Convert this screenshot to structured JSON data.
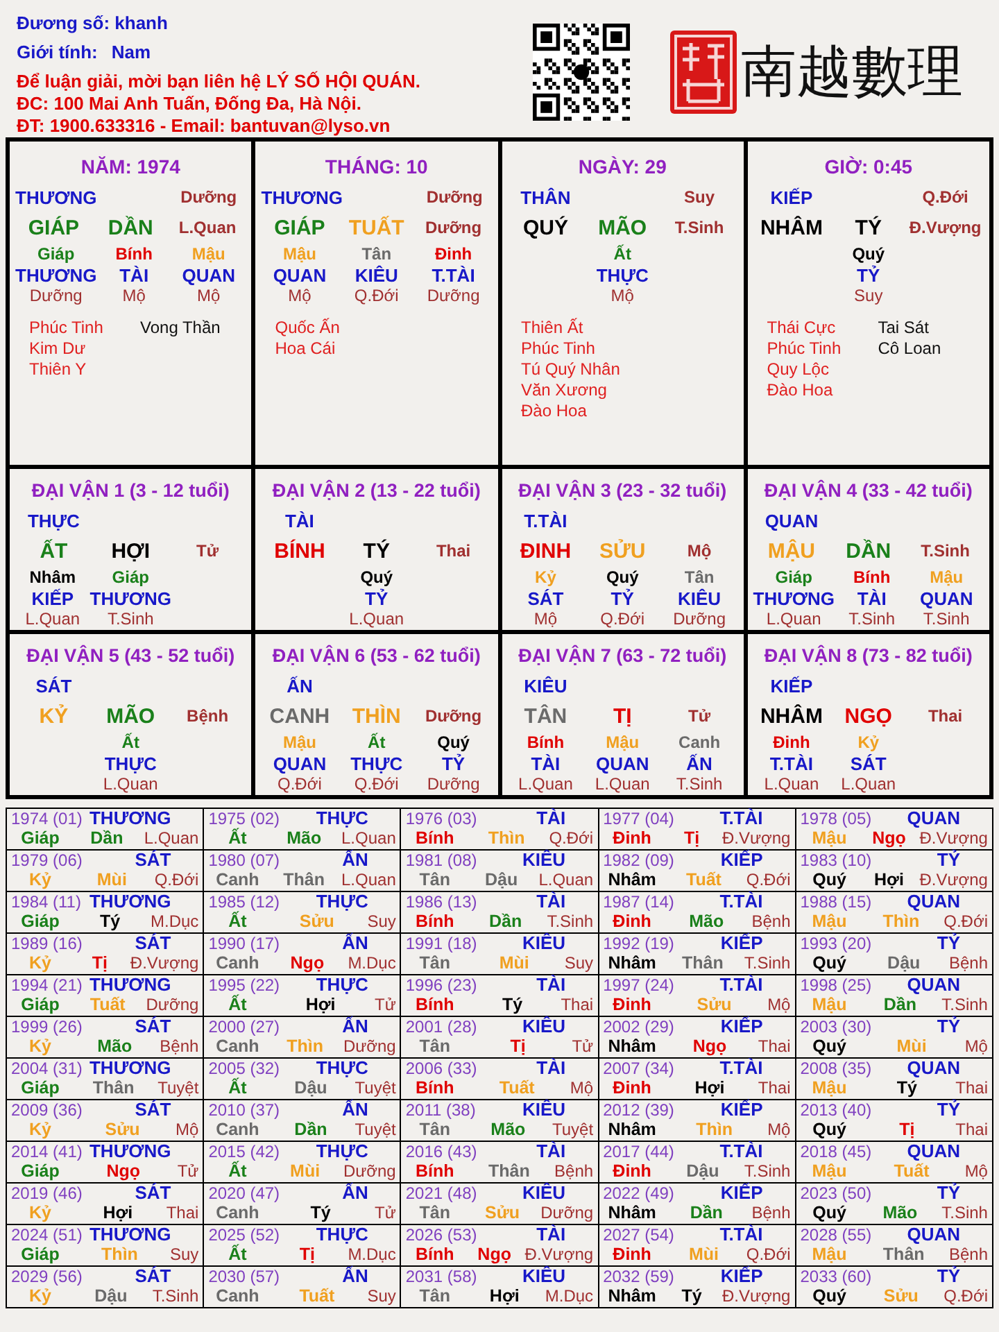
{
  "header": {
    "owner": "Đương số: khanh",
    "gender_label": "Giới tính:",
    "gender": "Nam",
    "contact_lines": [
      "Để luận giải, mời bạn liên hệ LÝ SỐ HỘI QUÁN.",
      "ĐC: 100 Mai Anh Tuấn, Đống Đa, Hà Nội.",
      "ĐT: 1900.633316 - Email: bantuvan@lyso.vn"
    ],
    "brand": "南越數理"
  },
  "pillars": [
    {
      "title": "NĂM: 1974",
      "god": "THƯƠNG",
      "stem_stage": "Dưỡng",
      "stem": {
        "text": "GIÁP",
        "color": "#1a801a"
      },
      "branch": {
        "text": "DẦN",
        "color": "#1a801a"
      },
      "branch_stage": "L.Quan",
      "hidden": [
        {
          "stem": "Giáp",
          "color": "#1a801a",
          "god": "THƯƠNG",
          "stage": "Dưỡng"
        },
        {
          "stem": "Bính",
          "color": "#e00000",
          "god": "TÀI",
          "stage": "Mộ"
        },
        {
          "stem": "Mậu",
          "color": "#f0a020",
          "god": "QUAN",
          "stage": "Mộ"
        }
      ],
      "star_names_1": [
        "Phúc Tinh",
        "Kim Dư",
        "Thiên Y"
      ],
      "star_names_2": [
        "Vong Thần"
      ]
    },
    {
      "title": "THÁNG: 10",
      "god": "THƯƠNG",
      "stem_stage": "Dưỡng",
      "stem": {
        "text": "GIÁP",
        "color": "#1a801a"
      },
      "branch": {
        "text": "TUẤT",
        "color": "#f0a020"
      },
      "branch_stage": "Dưỡng",
      "hidden": [
        {
          "stem": "Mậu",
          "color": "#f0a020",
          "god": "QUAN",
          "stage": "Mộ"
        },
        {
          "stem": "Tân",
          "color": "#6a6a6a",
          "god": "KIÊU",
          "stage": "Q.Đới"
        },
        {
          "stem": "Đinh",
          "color": "#e00000",
          "god": "T.TÀI",
          "stage": "Dưỡng"
        }
      ],
      "star_names_1": [
        "Quốc Ấn",
        "Hoa Cái"
      ]
    },
    {
      "title": "NGÀY: 29",
      "god": "THÂN",
      "stem_stage": "Suy",
      "stem": {
        "text": "QUÝ",
        "color": "#000000"
      },
      "branch": {
        "text": "MÃO",
        "color": "#1a801a"
      },
      "branch_stage": "T.Sinh",
      "hidden": [
        {
          "stem": "Ất",
          "color": "#1a801a",
          "god": "THỰC",
          "stage": "Mộ"
        }
      ],
      "star_names_1": [
        "Thiên Ất",
        "Phúc Tinh",
        "Tú Quý Nhân",
        "Văn Xương",
        "Đào Hoa"
      ]
    },
    {
      "title": "GIỜ: 0:45",
      "god": "KIẾP",
      "stem_stage": "Q.Đới",
      "stem": {
        "text": "NHÂM",
        "color": "#000000"
      },
      "branch": {
        "text": "TÝ",
        "color": "#000000"
      },
      "branch_stage": "Đ.Vượng",
      "hidden": [
        {
          "stem": "Quý",
          "color": "#000000",
          "god": "TỶ",
          "stage": "Suy"
        }
      ],
      "star_names_1": [
        "Thái Cực",
        "Phúc Tinh",
        "Quy Lộc",
        "Đào Hoa"
      ],
      "star_names_2": [
        "Tai Sát",
        "Cô Loan"
      ]
    }
  ],
  "luck_periods": [
    {
      "title": "ĐẠI VẬN 1 (3 - 12 tuổi)",
      "god": "THỰC",
      "stem": {
        "text": "ẤT",
        "color": "#1a801a"
      },
      "branch": {
        "text": "HỢI",
        "color": "#000000"
      },
      "stage": "Tử",
      "hidden": [
        {
          "stem": "Nhâm",
          "color": "#000000",
          "god": "KIẾP",
          "stage": "L.Quan"
        },
        {
          "stem": "Giáp",
          "color": "#1a801a",
          "god": "THƯƠNG",
          "stage": "T.Sinh"
        }
      ]
    },
    {
      "title": "ĐẠI VẬN 2 (13 - 22 tuổi)",
      "god": "TÀI",
      "stem": {
        "text": "BÍNH",
        "color": "#e00000"
      },
      "branch": {
        "text": "TÝ",
        "color": "#000000"
      },
      "stage": "Thai",
      "hidden": [
        {
          "stem": "Quý",
          "color": "#000000",
          "god": "TỶ",
          "stage": "L.Quan"
        }
      ]
    },
    {
      "title": "ĐẠI VẬN 3 (23 - 32 tuổi)",
      "god": "T.TÀI",
      "stem": {
        "text": "ĐINH",
        "color": "#e00000"
      },
      "branch": {
        "text": "SỬU",
        "color": "#f0a020"
      },
      "stage": "Mộ",
      "hidden": [
        {
          "stem": "Kỷ",
          "color": "#f0a020",
          "god": "SÁT",
          "stage": "Mộ"
        },
        {
          "stem": "Quý",
          "color": "#000000",
          "god": "TỶ",
          "stage": "Q.Đới"
        },
        {
          "stem": "Tân",
          "color": "#6a6a6a",
          "god": "KIÊU",
          "stage": "Dưỡng"
        }
      ]
    },
    {
      "title": "ĐẠI VẬN 4 (33 - 42 tuổi)",
      "god": "QUAN",
      "stem": {
        "text": "MẬU",
        "color": "#f0a020"
      },
      "branch": {
        "text": "DẦN",
        "color": "#1a801a"
      },
      "stage": "T.Sinh",
      "hidden": [
        {
          "stem": "Giáp",
          "color": "#1a801a",
          "god": "THƯƠNG",
          "stage": "L.Quan"
        },
        {
          "stem": "Bính",
          "color": "#e00000",
          "god": "TÀI",
          "stage": "T.Sinh"
        },
        {
          "stem": "Mậu",
          "color": "#f0a020",
          "god": "QUAN",
          "stage": "T.Sinh"
        }
      ]
    },
    {
      "title": "ĐẠI VẬN 5 (43 - 52 tuổi)",
      "god": "SÁT",
      "stem": {
        "text": "KỶ",
        "color": "#f0a020"
      },
      "branch": {
        "text": "MÃO",
        "color": "#1a801a"
      },
      "stage": "Bệnh",
      "hidden": [
        {
          "stem": "Ất",
          "color": "#1a801a",
          "god": "THỰC",
          "stage": "L.Quan"
        }
      ]
    },
    {
      "title": "ĐẠI VẬN 6 (53 - 62 tuổi)",
      "god": "ẤN",
      "stem": {
        "text": "CANH",
        "color": "#6a6a6a"
      },
      "branch": {
        "text": "THÌN",
        "color": "#f0a020"
      },
      "stage": "Dưỡng",
      "hidden": [
        {
          "stem": "Mậu",
          "color": "#f0a020",
          "god": "QUAN",
          "stage": "Q.Đới"
        },
        {
          "stem": "Ất",
          "color": "#1a801a",
          "god": "THỰC",
          "stage": "Q.Đới"
        },
        {
          "stem": "Quý",
          "color": "#000000",
          "god": "TỶ",
          "stage": "Dưỡng"
        }
      ]
    },
    {
      "title": "ĐẠI VẬN 7 (63 - 72 tuổi)",
      "god": "KIÊU",
      "stem": {
        "text": "TÂN",
        "color": "#6a6a6a"
      },
      "branch": {
        "text": "TỊ",
        "color": "#e00000"
      },
      "stage": "Tử",
      "hidden": [
        {
          "stem": "Bính",
          "color": "#e00000",
          "god": "TÀI",
          "stage": "L.Quan"
        },
        {
          "stem": "Mậu",
          "color": "#f0a020",
          "god": "QUAN",
          "stage": "L.Quan"
        },
        {
          "stem": "Canh",
          "color": "#6a6a6a",
          "god": "ẤN",
          "stage": "T.Sinh"
        }
      ]
    },
    {
      "title": "ĐẠI VẬN 8 (73 - 82 tuổi)",
      "god": "KIẾP",
      "stem": {
        "text": "NHÂM",
        "color": "#000000"
      },
      "branch": {
        "text": "NGỌ",
        "color": "#e00000"
      },
      "stage": "Thai",
      "hidden": [
        {
          "stem": "Đinh",
          "color": "#e00000",
          "god": "T.TÀI",
          "stage": "L.Quan"
        },
        {
          "stem": "Kỷ",
          "color": "#f0a020",
          "god": "SÁT",
          "stage": "L.Quan"
        }
      ]
    }
  ],
  "years": [
    {
      "year": "1974 (01)",
      "god": "THƯƠNG",
      "stem": {
        "text": "Giáp",
        "color": "#1a801a"
      },
      "branch": {
        "text": "Dần",
        "color": "#1a801a"
      },
      "stage": "L.Quan"
    },
    {
      "year": "1975 (02)",
      "god": "THỰC",
      "stem": {
        "text": "Ất",
        "color": "#1a801a"
      },
      "branch": {
        "text": "Mão",
        "color": "#1a801a"
      },
      "stage": "L.Quan"
    },
    {
      "year": "1976 (03)",
      "god": "TÀI",
      "stem": {
        "text": "Bính",
        "color": "#e00000"
      },
      "branch": {
        "text": "Thìn",
        "color": "#f0a020"
      },
      "stage": "Q.Đới"
    },
    {
      "year": "1977 (04)",
      "god": "T.TÀI",
      "stem": {
        "text": "Đinh",
        "color": "#e00000"
      },
      "branch": {
        "text": "Tị",
        "color": "#e00000"
      },
      "stage": "Đ.Vượng"
    },
    {
      "year": "1978 (05)",
      "god": "QUAN",
      "stem": {
        "text": "Mậu",
        "color": "#f0a020"
      },
      "branch": {
        "text": "Ngọ",
        "color": "#e00000"
      },
      "stage": "Đ.Vượng"
    },
    {
      "year": "1979 (06)",
      "god": "SÁT",
      "stem": {
        "text": "Kỷ",
        "color": "#f0a020"
      },
      "branch": {
        "text": "Mùi",
        "color": "#f0a020"
      },
      "stage": "Q.Đới"
    },
    {
      "year": "1980 (07)",
      "god": "ẤN",
      "stem": {
        "text": "Canh",
        "color": "#6a6a6a"
      },
      "branch": {
        "text": "Thân",
        "color": "#6a6a6a"
      },
      "stage": "L.Quan"
    },
    {
      "year": "1981 (08)",
      "god": "KIÊU",
      "stem": {
        "text": "Tân",
        "color": "#6a6a6a"
      },
      "branch": {
        "text": "Dậu",
        "color": "#6a6a6a"
      },
      "stage": "L.Quan"
    },
    {
      "year": "1982 (09)",
      "god": "KIẾP",
      "stem": {
        "text": "Nhâm",
        "color": "#000000"
      },
      "branch": {
        "text": "Tuất",
        "color": "#f0a020"
      },
      "stage": "Q.Đới"
    },
    {
      "year": "1983 (10)",
      "god": "TỶ",
      "stem": {
        "text": "Quý",
        "color": "#000000"
      },
      "branch": {
        "text": "Hợi",
        "color": "#000000"
      },
      "stage": "Đ.Vượng"
    },
    {
      "year": "1984 (11)",
      "god": "THƯƠNG",
      "stem": {
        "text": "Giáp",
        "color": "#1a801a"
      },
      "branch": {
        "text": "Tý",
        "color": "#000000"
      },
      "stage": "M.Dục"
    },
    {
      "year": "1985 (12)",
      "god": "THỰC",
      "stem": {
        "text": "Ất",
        "color": "#1a801a"
      },
      "branch": {
        "text": "Sửu",
        "color": "#f0a020"
      },
      "stage": "Suy"
    },
    {
      "year": "1986 (13)",
      "god": "TÀI",
      "stem": {
        "text": "Bính",
        "color": "#e00000"
      },
      "branch": {
        "text": "Dần",
        "color": "#1a801a"
      },
      "stage": "T.Sinh"
    },
    {
      "year": "1987 (14)",
      "god": "T.TÀI",
      "stem": {
        "text": "Đinh",
        "color": "#e00000"
      },
      "branch": {
        "text": "Mão",
        "color": "#1a801a"
      },
      "stage": "Bệnh"
    },
    {
      "year": "1988 (15)",
      "god": "QUAN",
      "stem": {
        "text": "Mậu",
        "color": "#f0a020"
      },
      "branch": {
        "text": "Thìn",
        "color": "#f0a020"
      },
      "stage": "Q.Đới"
    },
    {
      "year": "1989 (16)",
      "god": "SÁT",
      "stem": {
        "text": "Kỷ",
        "color": "#f0a020"
      },
      "branch": {
        "text": "Tị",
        "color": "#e00000"
      },
      "stage": "Đ.Vượng"
    },
    {
      "year": "1990 (17)",
      "god": "ẤN",
      "stem": {
        "text": "Canh",
        "color": "#6a6a6a"
      },
      "branch": {
        "text": "Ngọ",
        "color": "#e00000"
      },
      "stage": "M.Dục"
    },
    {
      "year": "1991 (18)",
      "god": "KIÊU",
      "stem": {
        "text": "Tân",
        "color": "#6a6a6a"
      },
      "branch": {
        "text": "Mùi",
        "color": "#f0a020"
      },
      "stage": "Suy"
    },
    {
      "year": "1992 (19)",
      "god": "KIẾP",
      "stem": {
        "text": "Nhâm",
        "color": "#000000"
      },
      "branch": {
        "text": "Thân",
        "color": "#6a6a6a"
      },
      "stage": "T.Sinh"
    },
    {
      "year": "1993 (20)",
      "god": "TỶ",
      "stem": {
        "text": "Quý",
        "color": "#000000"
      },
      "branch": {
        "text": "Dậu",
        "color": "#6a6a6a"
      },
      "stage": "Bệnh"
    },
    {
      "year": "1994 (21)",
      "god": "THƯƠNG",
      "stem": {
        "text": "Giáp",
        "color": "#1a801a"
      },
      "branch": {
        "text": "Tuất",
        "color": "#f0a020"
      },
      "stage": "Dưỡng"
    },
    {
      "year": "1995 (22)",
      "god": "THỰC",
      "stem": {
        "text": "Ất",
        "color": "#1a801a"
      },
      "branch": {
        "text": "Hợi",
        "color": "#000000"
      },
      "stage": "Tử"
    },
    {
      "year": "1996 (23)",
      "god": "TÀI",
      "stem": {
        "text": "Bính",
        "color": "#e00000"
      },
      "branch": {
        "text": "Tý",
        "color": "#000000"
      },
      "stage": "Thai"
    },
    {
      "year": "1997 (24)",
      "god": "T.TÀI",
      "stem": {
        "text": "Đinh",
        "color": "#e00000"
      },
      "branch": {
        "text": "Sửu",
        "color": "#f0a020"
      },
      "stage": "Mộ"
    },
    {
      "year": "1998 (25)",
      "god": "QUAN",
      "stem": {
        "text": "Mậu",
        "color": "#f0a020"
      },
      "branch": {
        "text": "Dần",
        "color": "#1a801a"
      },
      "stage": "T.Sinh"
    },
    {
      "year": "1999 (26)",
      "god": "SÁT",
      "stem": {
        "text": "Kỷ",
        "color": "#f0a020"
      },
      "branch": {
        "text": "Mão",
        "color": "#1a801a"
      },
      "stage": "Bệnh"
    },
    {
      "year": "2000 (27)",
      "god": "ẤN",
      "stem": {
        "text": "Canh",
        "color": "#6a6a6a"
      },
      "branch": {
        "text": "Thìn",
        "color": "#f0a020"
      },
      "stage": "Dưỡng"
    },
    {
      "year": "2001 (28)",
      "god": "KIÊU",
      "stem": {
        "text": "Tân",
        "color": "#6a6a6a"
      },
      "branch": {
        "text": "Tị",
        "color": "#e00000"
      },
      "stage": "Tử"
    },
    {
      "year": "2002 (29)",
      "god": "KIẾP",
      "stem": {
        "text": "Nhâm",
        "color": "#000000"
      },
      "branch": {
        "text": "Ngọ",
        "color": "#e00000"
      },
      "stage": "Thai"
    },
    {
      "year": "2003 (30)",
      "god": "TỶ",
      "stem": {
        "text": "Quý",
        "color": "#000000"
      },
      "branch": {
        "text": "Mùi",
        "color": "#f0a020"
      },
      "stage": "Mộ"
    },
    {
      "year": "2004 (31)",
      "god": "THƯƠNG",
      "stem": {
        "text": "Giáp",
        "color": "#1a801a"
      },
      "branch": {
        "text": "Thân",
        "color": "#6a6a6a"
      },
      "stage": "Tuyệt"
    },
    {
      "year": "2005 (32)",
      "god": "THỰC",
      "stem": {
        "text": "Ất",
        "color": "#1a801a"
      },
      "branch": {
        "text": "Dậu",
        "color": "#6a6a6a"
      },
      "stage": "Tuyệt"
    },
    {
      "year": "2006 (33)",
      "god": "TÀI",
      "stem": {
        "text": "Bính",
        "color": "#e00000"
      },
      "branch": {
        "text": "Tuất",
        "color": "#f0a020"
      },
      "stage": "Mộ"
    },
    {
      "year": "2007 (34)",
      "god": "T.TÀI",
      "stem": {
        "text": "Đinh",
        "color": "#e00000"
      },
      "branch": {
        "text": "Hợi",
        "color": "#000000"
      },
      "stage": "Thai"
    },
    {
      "year": "2008 (35)",
      "god": "QUAN",
      "stem": {
        "text": "Mậu",
        "color": "#f0a020"
      },
      "branch": {
        "text": "Tý",
        "color": "#000000"
      },
      "stage": "Thai"
    },
    {
      "year": "2009 (36)",
      "god": "SÁT",
      "stem": {
        "text": "Kỷ",
        "color": "#f0a020"
      },
      "branch": {
        "text": "Sửu",
        "color": "#f0a020"
      },
      "stage": "Mộ"
    },
    {
      "year": "2010 (37)",
      "god": "ẤN",
      "stem": {
        "text": "Canh",
        "color": "#6a6a6a"
      },
      "branch": {
        "text": "Dần",
        "color": "#1a801a"
      },
      "stage": "Tuyệt"
    },
    {
      "year": "2011 (38)",
      "god": "KIÊU",
      "stem": {
        "text": "Tân",
        "color": "#6a6a6a"
      },
      "branch": {
        "text": "Mão",
        "color": "#1a801a"
      },
      "stage": "Tuyệt"
    },
    {
      "year": "2012 (39)",
      "god": "KIẾP",
      "stem": {
        "text": "Nhâm",
        "color": "#000000"
      },
      "branch": {
        "text": "Thìn",
        "color": "#f0a020"
      },
      "stage": "Mộ"
    },
    {
      "year": "2013 (40)",
      "god": "TỶ",
      "stem": {
        "text": "Quý",
        "color": "#000000"
      },
      "branch": {
        "text": "Tị",
        "color": "#e00000"
      },
      "stage": "Thai"
    },
    {
      "year": "2014 (41)",
      "god": "THƯƠNG",
      "stem": {
        "text": "Giáp",
        "color": "#1a801a"
      },
      "branch": {
        "text": "Ngọ",
        "color": "#e00000"
      },
      "stage": "Tử"
    },
    {
      "year": "2015 (42)",
      "god": "THỰC",
      "stem": {
        "text": "Ất",
        "color": "#1a801a"
      },
      "branch": {
        "text": "Mùi",
        "color": "#f0a020"
      },
      "stage": "Dưỡng"
    },
    {
      "year": "2016 (43)",
      "god": "TÀI",
      "stem": {
        "text": "Bính",
        "color": "#e00000"
      },
      "branch": {
        "text": "Thân",
        "color": "#6a6a6a"
      },
      "stage": "Bệnh"
    },
    {
      "year": "2017 (44)",
      "god": "T.TÀI",
      "stem": {
        "text": "Đinh",
        "color": "#e00000"
      },
      "branch": {
        "text": "Dậu",
        "color": "#6a6a6a"
      },
      "stage": "T.Sinh"
    },
    {
      "year": "2018 (45)",
      "god": "QUAN",
      "stem": {
        "text": "Mậu",
        "color": "#f0a020"
      },
      "branch": {
        "text": "Tuất",
        "color": "#f0a020"
      },
      "stage": "Mộ"
    },
    {
      "year": "2019 (46)",
      "god": "SÁT",
      "stem": {
        "text": "Kỷ",
        "color": "#f0a020"
      },
      "branch": {
        "text": "Hợi",
        "color": "#000000"
      },
      "stage": "Thai"
    },
    {
      "year": "2020 (47)",
      "god": "ẤN",
      "stem": {
        "text": "Canh",
        "color": "#6a6a6a"
      },
      "branch": {
        "text": "Tý",
        "color": "#000000"
      },
      "stage": "Tử"
    },
    {
      "year": "2021 (48)",
      "god": "KIÊU",
      "stem": {
        "text": "Tân",
        "color": "#6a6a6a"
      },
      "branch": {
        "text": "Sửu",
        "color": "#f0a020"
      },
      "stage": "Dưỡng"
    },
    {
      "year": "2022 (49)",
      "god": "KIẾP",
      "stem": {
        "text": "Nhâm",
        "color": "#000000"
      },
      "branch": {
        "text": "Dần",
        "color": "#1a801a"
      },
      "stage": "Bệnh"
    },
    {
      "year": "2023 (50)",
      "god": "TỶ",
      "stem": {
        "text": "Quý",
        "color": "#000000"
      },
      "branch": {
        "text": "Mão",
        "color": "#1a801a"
      },
      "stage": "T.Sinh"
    },
    {
      "year": "2024 (51)",
      "god": "THƯƠNG",
      "stem": {
        "text": "Giáp",
        "color": "#1a801a"
      },
      "branch": {
        "text": "Thìn",
        "color": "#f0a020"
      },
      "stage": "Suy"
    },
    {
      "year": "2025 (52)",
      "god": "THỰC",
      "stem": {
        "text": "Ất",
        "color": "#1a801a"
      },
      "branch": {
        "text": "Tị",
        "color": "#e00000"
      },
      "stage": "M.Dục"
    },
    {
      "year": "2026 (53)",
      "god": "TÀI",
      "stem": {
        "text": "Bính",
        "color": "#e00000"
      },
      "branch": {
        "text": "Ngọ",
        "color": "#e00000"
      },
      "stage": "Đ.Vượng"
    },
    {
      "year": "2027 (54)",
      "god": "T.TÀI",
      "stem": {
        "text": "Đinh",
        "color": "#e00000"
      },
      "branch": {
        "text": "Mùi",
        "color": "#f0a020"
      },
      "stage": "Q.Đới"
    },
    {
      "year": "2028 (55)",
      "god": "QUAN",
      "stem": {
        "text": "Mậu",
        "color": "#f0a020"
      },
      "branch": {
        "text": "Thân",
        "color": "#6a6a6a"
      },
      "stage": "Bệnh"
    },
    {
      "year": "2029 (56)",
      "god": "SÁT",
      "stem": {
        "text": "Kỷ",
        "color": "#f0a020"
      },
      "branch": {
        "text": "Dậu",
        "color": "#6a6a6a"
      },
      "stage": "T.Sinh"
    },
    {
      "year": "2030 (57)",
      "god": "ẤN",
      "stem": {
        "text": "Canh",
        "color": "#6a6a6a"
      },
      "branch": {
        "text": "Tuất",
        "color": "#f0a020"
      },
      "stage": "Suy"
    },
    {
      "year": "2031 (58)",
      "god": "KIÊU",
      "stem": {
        "text": "Tân",
        "color": "#6a6a6a"
      },
      "branch": {
        "text": "Hợi",
        "color": "#000000"
      },
      "stage": "M.Dục"
    },
    {
      "year": "2032 (59)",
      "god": "KIẾP",
      "stem": {
        "text": "Nhâm",
        "color": "#000000"
      },
      "branch": {
        "text": "Tý",
        "color": "#000000"
      },
      "stage": "Đ.Vượng"
    },
    {
      "year": "2033 (60)",
      "god": "TỶ",
      "stem": {
        "text": "Quý",
        "color": "#000000"
      },
      "branch": {
        "text": "Sửu",
        "color": "#f0a020"
      },
      "stage": "Q.Đới"
    }
  ]
}
